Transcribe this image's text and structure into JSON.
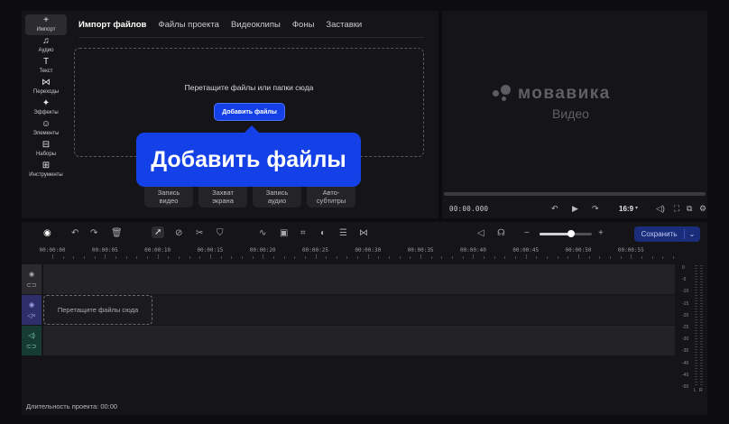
{
  "sidebar": {
    "items": [
      {
        "icon": "plus-icon",
        "glyph": "+",
        "label": "Импорт",
        "active": true
      },
      {
        "icon": "music-note-icon",
        "glyph": "♫",
        "label": "Аудио"
      },
      {
        "icon": "text-icon",
        "glyph": "T",
        "label": "Текст"
      },
      {
        "icon": "transitions-icon",
        "glyph": "⋈",
        "label": "Переходы"
      },
      {
        "icon": "sparkle-icon",
        "glyph": "✦",
        "label": "Эффекты"
      },
      {
        "icon": "elements-icon",
        "glyph": "☺",
        "label": "Элементы"
      },
      {
        "icon": "bag-icon",
        "glyph": "⊟",
        "label": "Наборы"
      },
      {
        "icon": "tools-icon",
        "glyph": "⊞",
        "label": "Инструменты"
      }
    ]
  },
  "tabs": [
    "Импорт файлов",
    "Файлы проекта",
    "Видеоклипы",
    "Фоны",
    "Заставки"
  ],
  "dropzone": {
    "text": "Перетащите файлы или папки сюда",
    "add_button": "Добавить файлы"
  },
  "tooltip": "Добавить файлы",
  "capture": [
    {
      "line1": "Запись",
      "line2": "видео"
    },
    {
      "line1": "Захват",
      "line2": "экрана"
    },
    {
      "line1": "Запись",
      "line2": "аудио"
    },
    {
      "line1": "Авто-",
      "line2": "субтитры"
    }
  ],
  "preview": {
    "logo": "мовавика",
    "logo_sub": "Видео",
    "time": "00:00.000",
    "aspect": "16:9"
  },
  "timeline": {
    "save_label": "Сохранить",
    "zoom_level": 0.6,
    "ticks": [
      "00:00:00",
      "00:00:05",
      "00:00:10",
      "00:00:15",
      "00:00:20",
      "00:00:25",
      "00:00:30",
      "00:00:35",
      "00:00:40",
      "00:00:45",
      "00:00:50",
      "00:00:55"
    ],
    "drop_text": "Перетащите файлы сюда",
    "duration": "Длительность проекта: 00:00",
    "meter_labels": [
      "0",
      "-5",
      "-10",
      "-15",
      "-20",
      "-25",
      "-30",
      "-35",
      "-40",
      "-45",
      "-50"
    ],
    "meter_channels": [
      "L",
      "R"
    ]
  },
  "colors": {
    "accent": "#1440e8",
    "video_track": "#2e2f6a",
    "audio_track": "#163b33"
  }
}
